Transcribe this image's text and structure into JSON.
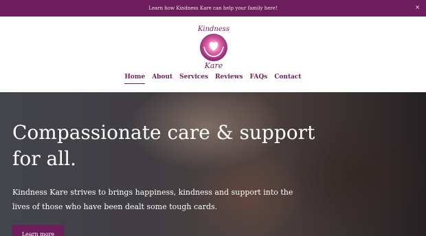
{
  "announcement": {
    "text": "Learn how Kindness Kare can help your family here!",
    "close_glyph": "×"
  },
  "logo": {
    "line1": "Kindness",
    "line2": "Kare"
  },
  "nav": {
    "items": [
      "Home",
      "About",
      "Services",
      "Reviews",
      "FAQs",
      "Contact"
    ],
    "active_index": 0
  },
  "hero": {
    "heading": "Compassionate care & support for all.",
    "body": "Kindness Kare strives to brings happiness, kindness and support into the lives of those who have been dealt some tough cards.",
    "button_label": "Learn more"
  },
  "colors": {
    "brand": "#6e1d5c",
    "accent": "#c24f93"
  }
}
